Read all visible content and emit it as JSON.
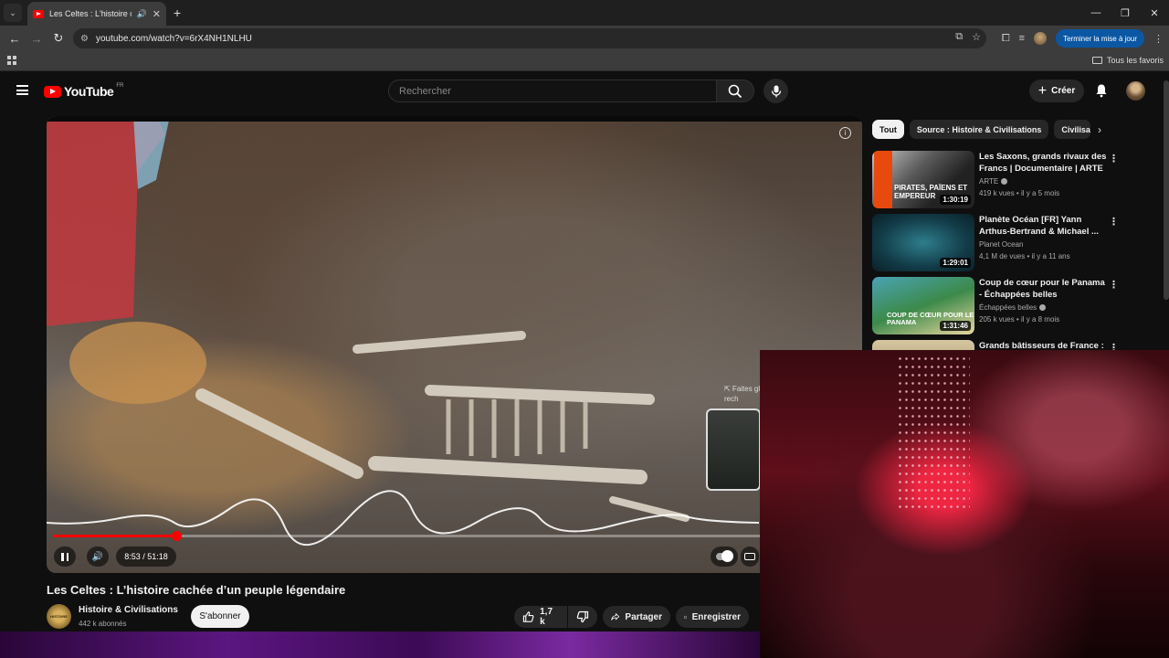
{
  "browser": {
    "tab_title": "Les Celtes : L'histoire cachée d'un peuple légendaire - YouTube",
    "url": "youtube.com/watch?v=6rX4NH1NLHU",
    "update_button": "Terminer la mise à jour",
    "all_bookmarks": "Tous les favoris"
  },
  "youtube": {
    "logo_text": "YouTube",
    "region": "FR",
    "search_placeholder": "Rechercher",
    "create_label": "Créer"
  },
  "player": {
    "hint_line1": "⇱ Faites gl",
    "hint_line2": "rech",
    "current_time": "8:53",
    "duration": "51:18",
    "progress": 0.173
  },
  "video": {
    "title": "Les Celtes : L’histoire cachée d’un peuple légendaire",
    "channel": "Histoire & Civilisations",
    "channel_avatar_text": "HISTOIRE",
    "subscribers": "442 k abonnés",
    "subscribe_label": "S'abonner",
    "likes": "1,7 k",
    "share_label": "Partager",
    "save_label": "Enregistrer"
  },
  "chips": [
    "Tout",
    "Source : Histoire & Civilisations",
    "Civilisations"
  ],
  "recommendations": [
    {
      "title": "Les Saxons, grands rivaux des Francs | Documentaire | ARTE",
      "channel": "ARTE",
      "verified": true,
      "meta": "419 k vues • il y a 5 mois",
      "duration": "1:30:19",
      "thumb_text": "PIRATES, PAÏENS ET EMPEREUR"
    },
    {
      "title": "Planète Océan [FR] Yann Arthus-Bertrand & Michael ...",
      "channel": "Planet Ocean",
      "verified": false,
      "meta": "4,1 M de vues • il y a 11 ans",
      "duration": "1:29:01",
      "thumb_text": ""
    },
    {
      "title": "Coup de cœur pour le Panama - Échappées belles",
      "channel": "Échappées belles",
      "verified": true,
      "meta": "205 k vues • il y a 8 mois",
      "duration": "1:31:46",
      "thumb_text": "COUP DE CŒUR POUR LE PANAMA"
    },
    {
      "title": "Grands bâtisseurs de France :",
      "channel": "",
      "verified": false,
      "meta": "",
      "duration": "",
      "thumb_text": ""
    }
  ]
}
